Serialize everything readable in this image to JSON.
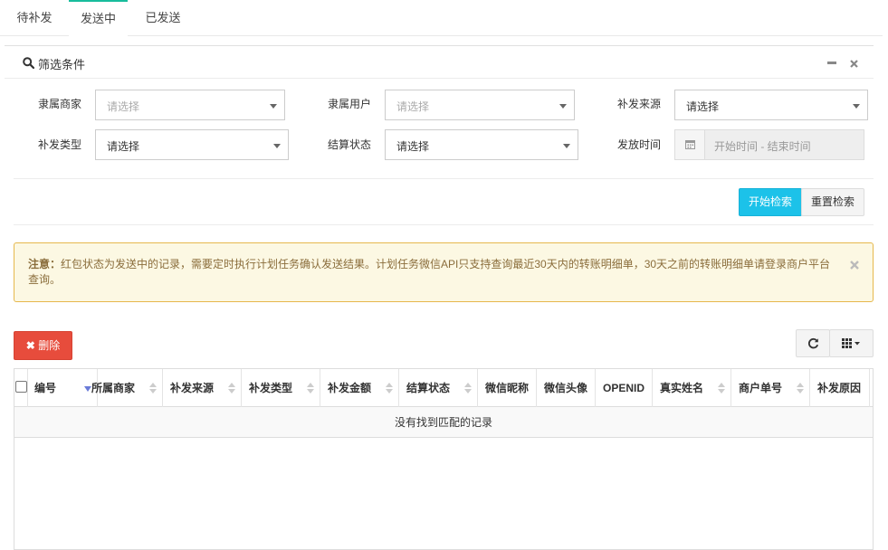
{
  "tabs": [
    "待补发",
    "发送中",
    "已发送"
  ],
  "filter": {
    "title": "筛选条件",
    "fields": [
      {
        "label": "隶属商家",
        "placeholder": "请选择"
      },
      {
        "label": "隶属用户",
        "placeholder": "请选择"
      },
      {
        "label": "补发来源",
        "value": "请选择"
      },
      {
        "label": "补发类型",
        "value": "请选择"
      },
      {
        "label": "结算状态",
        "value": "请选择"
      },
      {
        "label": "发放时间",
        "placeholder": "开始时间 - 结束时间"
      }
    ],
    "search_label": "开始检索",
    "reset_label": "重置检索"
  },
  "notice": {
    "prefix": "注意：",
    "text": "红包状态为发送中的记录，需要定时执行计划任务确认发送结果。计划任务微信API只支持查询最近30天内的转账明细单，30天之前的转账明细单请登录商户平台查询。"
  },
  "toolbar": {
    "delete_label": "删除"
  },
  "table": {
    "columns": [
      "编号",
      "所属商家",
      "补发来源",
      "补发类型",
      "补发金额",
      "结算状态",
      "微信昵称",
      "微信头像",
      "OPENID",
      "真实姓名",
      "商户单号",
      "补发原因"
    ],
    "empty_text": "没有找到匹配的记录"
  },
  "colors": {
    "accent": "#18bc9c",
    "info": "#1cc2e9",
    "danger": "#e74c3c",
    "warning_bg": "#fcf8e3",
    "warning_border": "#e6b84d"
  }
}
